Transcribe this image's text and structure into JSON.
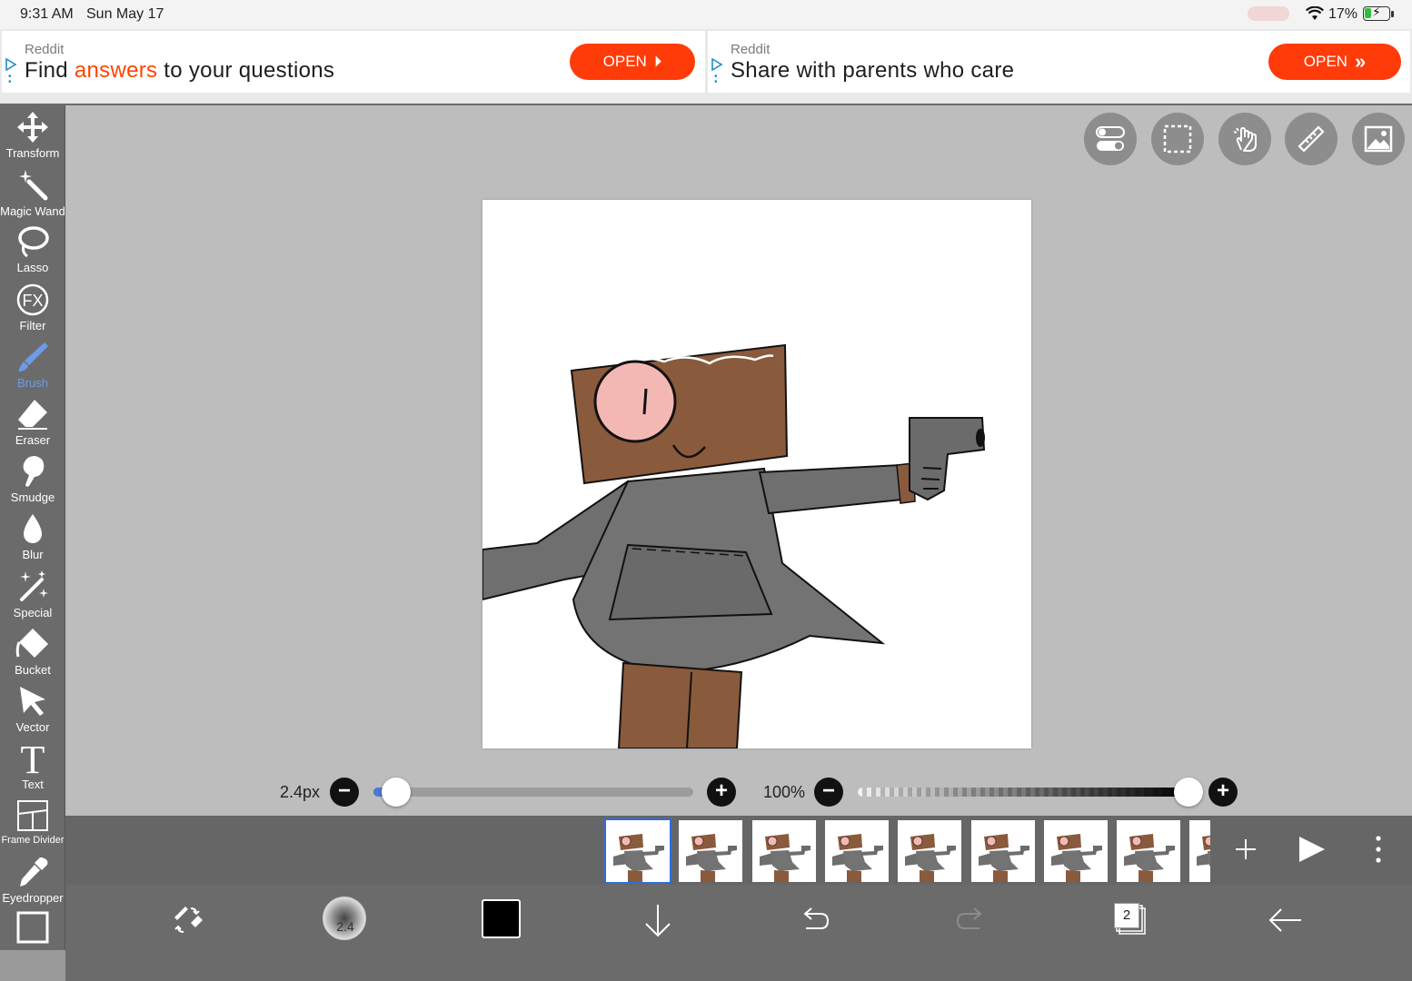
{
  "status_bar": {
    "time": "9:31 AM",
    "date": "Sun May 17",
    "battery_percent": "17%"
  },
  "ads": [
    {
      "brand": "Reddit",
      "headline_before": "Find ",
      "headline_highlight": "answers",
      "headline_after": " to your questions",
      "button_label": "OPEN",
      "button_arrow": "⏵"
    },
    {
      "brand": "Reddit",
      "headline_before": "Share with parents who care",
      "headline_highlight": "",
      "headline_after": "",
      "button_label": "OPEN",
      "button_arrow": "»"
    }
  ],
  "tools": [
    {
      "label": "Transform",
      "icon": "transform-icon"
    },
    {
      "label": "Magic Wand",
      "icon": "magic-wand-icon"
    },
    {
      "label": "Lasso",
      "icon": "lasso-icon"
    },
    {
      "label": "Filter",
      "icon": "fx-icon"
    },
    {
      "label": "Brush",
      "icon": "brush-icon",
      "active": true
    },
    {
      "label": "Eraser",
      "icon": "eraser-icon"
    },
    {
      "label": "Smudge",
      "icon": "smudge-icon"
    },
    {
      "label": "Blur",
      "icon": "blur-drop-icon"
    },
    {
      "label": "Special",
      "icon": "special-icon"
    },
    {
      "label": "Bucket",
      "icon": "bucket-icon"
    },
    {
      "label": "Vector",
      "icon": "vector-arrow-icon"
    },
    {
      "label": "Text",
      "icon": "text-icon"
    },
    {
      "label": "Frame Divider",
      "icon": "frame-divider-icon"
    },
    {
      "label": "Eyedropper",
      "icon": "eyedropper-icon"
    }
  ],
  "top_right_buttons": [
    "toggle-icon",
    "selection-icon",
    "hand-icon",
    "ruler-icon",
    "image-icon"
  ],
  "brush_size": {
    "label": "2.4px",
    "value_fraction": 0.07
  },
  "opacity": {
    "label": "100%",
    "value_fraction": 1.0
  },
  "frames": {
    "count": 9,
    "selected_index": 0
  },
  "bottom_bar": {
    "brush_preview_size": "2.4",
    "layers_count": "2",
    "current_color": "#000000"
  },
  "colors": {
    "accent_blue": "#4b78d3",
    "reddit_orange": "#ff3b0a",
    "toolbar_gray": "#6b6b6b"
  }
}
